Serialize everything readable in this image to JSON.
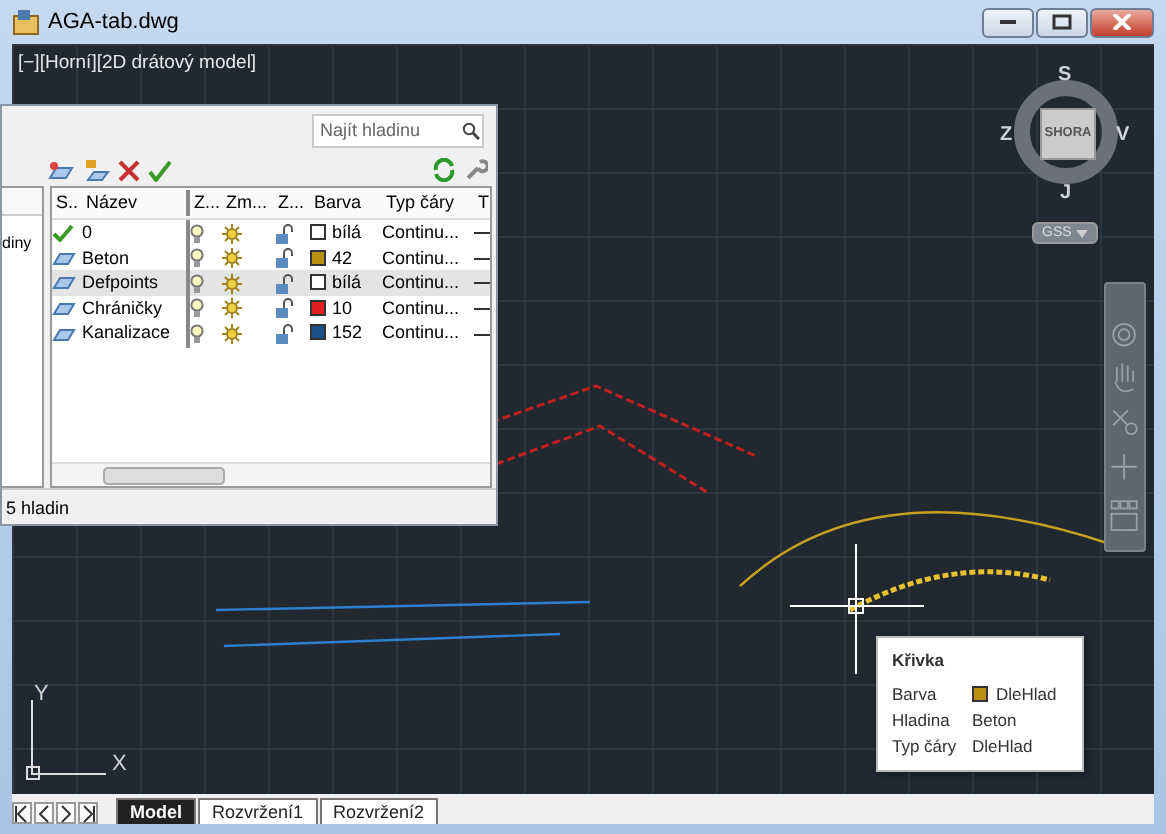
{
  "window": {
    "title": "AGA-tab.dwg"
  },
  "viewport": {
    "label": "[−][Horní][2D drátový model]"
  },
  "viewcube": {
    "north": "S",
    "south": "J",
    "west": "Z",
    "east": "V",
    "face": "SHORA",
    "ucs_menu": "GSS"
  },
  "ucs_icon": {
    "x_label": "X",
    "y_label": "Y"
  },
  "layer_panel": {
    "search": {
      "placeholder": "Najít hladinu"
    },
    "left_pane_text": "diny",
    "columns": [
      "S..",
      "Název",
      "Z...",
      "Zm...",
      "Z...",
      "Barva",
      "Typ čáry",
      "T"
    ],
    "rows": [
      {
        "current": true,
        "name": "0",
        "selected": false,
        "color": "#ffffff",
        "color_label": "bílá",
        "linetype": "Continu..."
      },
      {
        "current": false,
        "name": "Beton",
        "selected": false,
        "color": "#b8900e",
        "color_label": "42",
        "linetype": "Continu..."
      },
      {
        "current": false,
        "name": "Defpoints",
        "selected": true,
        "color": "#ffffff",
        "color_label": "bílá",
        "linetype": "Continu..."
      },
      {
        "current": false,
        "name": "Chráničky",
        "selected": false,
        "color": "#e02020",
        "color_label": "10",
        "linetype": "Continu..."
      },
      {
        "current": false,
        "name": "Kanalizace",
        "selected": false,
        "color": "#1a4f8a",
        "color_label": "152",
        "linetype": "Continu..."
      }
    ],
    "status": "5 hladin"
  },
  "tooltip": {
    "title": "Křivka",
    "rows": [
      {
        "label": "Barva",
        "value": "DleHlad",
        "color": "#b8900e"
      },
      {
        "label": "Hladina",
        "value": "Beton"
      },
      {
        "label": "Typ čáry",
        "value": "DleHlad"
      }
    ]
  },
  "layout_tabs": [
    {
      "label": "Model",
      "selected": true
    },
    {
      "label": "Rozvržení1",
      "selected": false
    },
    {
      "label": "Rozvržení2",
      "selected": false
    }
  ]
}
